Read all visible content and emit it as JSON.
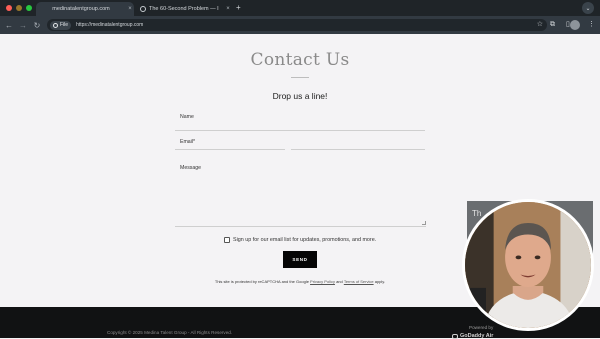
{
  "browser": {
    "tabs": [
      {
        "title": "medinatalentgroup.com",
        "active": true
      },
      {
        "title": "The 60-Second Problem — I",
        "active": false
      }
    ],
    "new_tab_label": "+",
    "tab_menu_label": "⌄",
    "site_chip_label": "File",
    "url": "https://medinatalentgroup.com",
    "icons": {
      "back": "back-arrow-icon",
      "forward": "forward-arrow-icon",
      "reload": "reload-icon",
      "bookmark": "star-icon",
      "extensions": "puzzle-icon",
      "side_panel": "side-panel-icon",
      "menu": "kebab-menu-icon"
    }
  },
  "page": {
    "heading": "Contact Us",
    "subheading": "Drop us a line!",
    "form": {
      "name_label": "Name",
      "email_label": "Email*",
      "message_label": "Message",
      "name_value": "",
      "email_value": "",
      "message_value": "",
      "newsletter_label": "Sign up for our email list for updates, promotions, and more.",
      "newsletter_checked": false,
      "submit_label": "SEND"
    },
    "recaptcha": {
      "prefix": "This site is protected by reCAPTCHA and the Google",
      "privacy_link": "Privacy Policy",
      "and": "and",
      "terms_link": "Terms of Service",
      "suffix": "apply."
    },
    "footer": {
      "copyright": "Copyright © 2025 Medina Talent Group - All Rights Reserved.",
      "powered_by": "Powered by",
      "provider": "GoDaddy Air"
    }
  },
  "overlay": {
    "card_text": "Th",
    "webcam": "presenter-webcam"
  },
  "colors": {
    "page_bg": "#f4f3f5",
    "footer_bg": "#111213",
    "button_bg": "#050505",
    "chrome_dark": "#1f2428",
    "toolbar": "#323a42"
  }
}
